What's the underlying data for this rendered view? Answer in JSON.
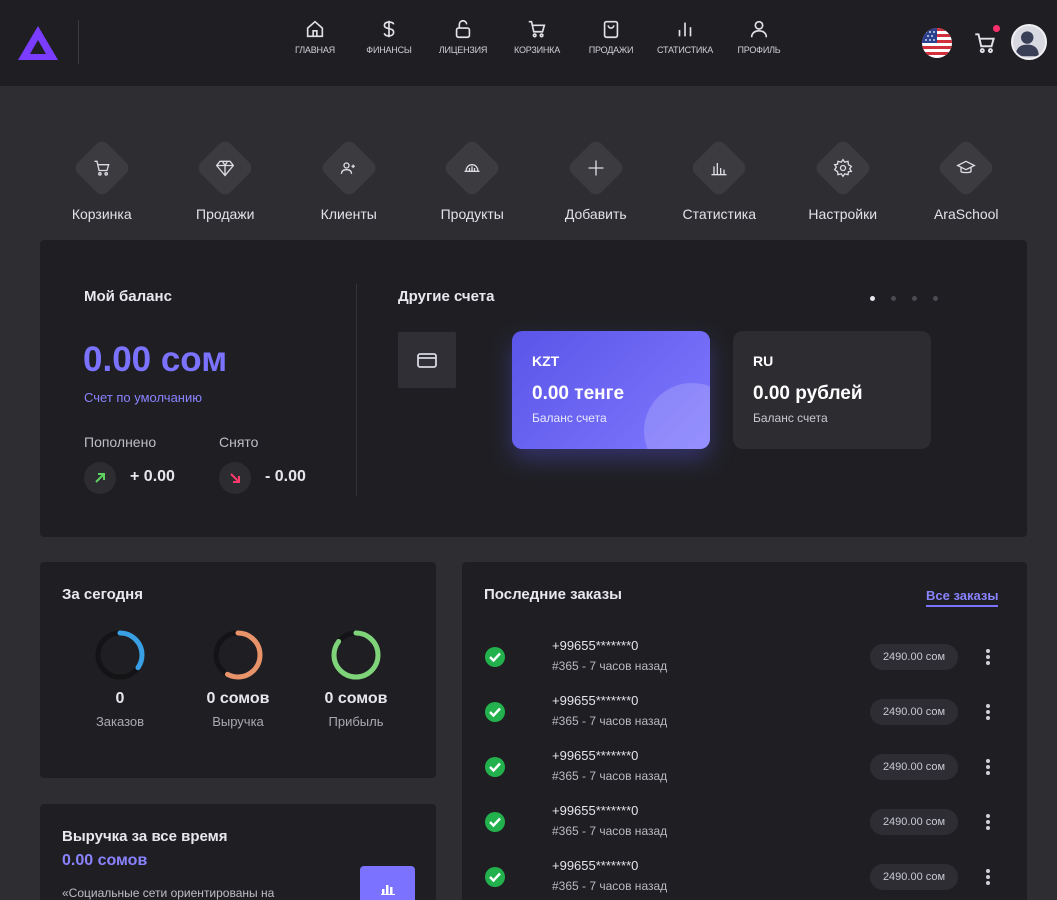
{
  "topnav": {
    "items": [
      {
        "label": "ГЛАВНАЯ",
        "icon": "home-icon"
      },
      {
        "label": "ФИНАНСЫ",
        "icon": "dollar-icon"
      },
      {
        "label": "ЛИЦЕНЗИЯ",
        "icon": "lock-icon"
      },
      {
        "label": "КОРЗИНКА",
        "icon": "cart-icon"
      },
      {
        "label": "ПРОДАЖИ",
        "icon": "bag-icon"
      },
      {
        "label": "СТАТИСТИКА",
        "icon": "bar-chart-icon"
      },
      {
        "label": "ПРОФИЛЬ",
        "icon": "user-icon"
      }
    ]
  },
  "quick_actions": [
    {
      "label": "Корзинка",
      "icon": "cart-icon"
    },
    {
      "label": "Продажи",
      "icon": "diamond-icon"
    },
    {
      "label": "Клиенты",
      "icon": "users-icon"
    },
    {
      "label": "Продукты",
      "icon": "product-icon"
    },
    {
      "label": "Добавить",
      "icon": "plus-icon"
    },
    {
      "label": "Статистика",
      "icon": "chart-icon"
    },
    {
      "label": "Настройки",
      "icon": "gear-icon"
    },
    {
      "label": "AraSchool",
      "icon": "graduation-cap-icon"
    }
  ],
  "balance": {
    "title": "Мой баланс",
    "amount": "0.00 сом",
    "default_label": "Счет по умолчанию",
    "deposited_label": "Пополнено",
    "deposited_value": "+ 0.00",
    "withdrawn_label": "Снято",
    "withdrawn_value": "- 0.00"
  },
  "other_accounts": {
    "title": "Другие счета",
    "cards": [
      {
        "code": "KZT",
        "amount": "0.00 тенге",
        "sub": "Баланс счета"
      },
      {
        "code": "RU",
        "amount": "0.00 рублей",
        "sub": "Баланс счета"
      }
    ]
  },
  "today": {
    "title": "За сегодня",
    "stats": [
      {
        "value": "0",
        "label": "Заказов",
        "color": "#3aa0e6"
      },
      {
        "value": "0 сомов",
        "label": "Выручка",
        "color": "#e8936a"
      },
      {
        "value": "0 сомов",
        "label": "Прибыль",
        "color": "#7fd47a"
      }
    ]
  },
  "revenue": {
    "title": "Выручка за все время",
    "amount": "0.00 сомов",
    "text": "«Социальные сети ориентированы на"
  },
  "orders": {
    "title": "Последние заказы",
    "all_link": "Все заказы",
    "rows": [
      {
        "phone": "+99655*******0",
        "meta": "#365 - 7 часов назад",
        "price": "2490.00 сом"
      },
      {
        "phone": "+99655*******0",
        "meta": "#365 - 7 часов назад",
        "price": "2490.00 сом"
      },
      {
        "phone": "+99655*******0",
        "meta": "#365 - 7 часов назад",
        "price": "2490.00 сом"
      },
      {
        "phone": "+99655*******0",
        "meta": "#365 - 7 часов назад",
        "price": "2490.00 сом"
      },
      {
        "phone": "+99655*******0",
        "meta": "#365 - 7 часов назад",
        "price": "2490.00 сом"
      }
    ]
  },
  "colors": {
    "accent": "#7b73ff",
    "background": "#2d2d32",
    "panel": "#1f1f23"
  }
}
